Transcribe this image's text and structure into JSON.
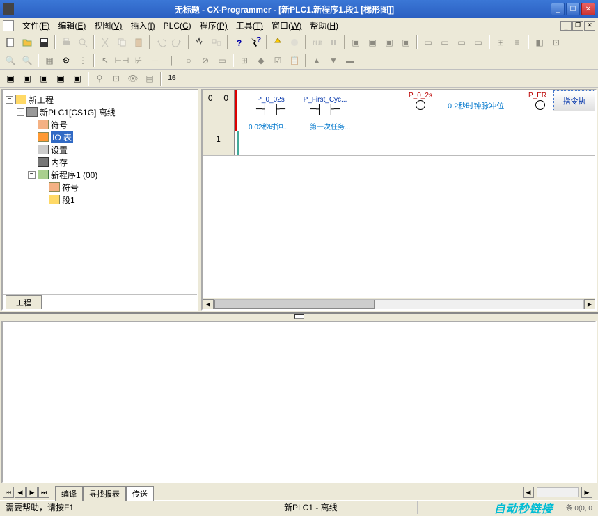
{
  "title": "无标题 - CX-Programmer - [新PLC1.新程序1.段1 [梯形图]]",
  "menu": {
    "file": "文件(",
    "edit": "编辑(",
    "view": "视图(",
    "insert": "插入(",
    "plc": "PLC(",
    "program": "程序(",
    "tools": "工具(",
    "window": "窗口(",
    "help": "帮助(",
    "file_k": "F)",
    "edit_k": "E)",
    "view_k": "V)",
    "insert_k": "I)",
    "plc_k": "C)",
    "program_k": "P)",
    "tools_k": "T)",
    "window_k": "W)",
    "help_k": "H)"
  },
  "toolbar3": {
    "sixteen": "16"
  },
  "tree": {
    "root": "新工程",
    "plc": "新PLC1[CS1G] 离线",
    "symbols": "符号",
    "io": "IO 表",
    "settings": "设置",
    "memory": "内存",
    "program": "新程序1 (00)",
    "psymbols": "符号",
    "section": "段1",
    "tab": "工程"
  },
  "ladder": {
    "rung0_a": "0",
    "rung0_b": "0",
    "rung1": "1",
    "c1": "P_0_02s",
    "c1sub": "0.02秒时钟...",
    "c2": "P_First_Cyc...",
    "c2sub": "第一次任务...",
    "coil1": "P_0_2s",
    "coil1_label": "0.2秒时钟脉冲位",
    "coil2": "P_ER",
    "end": "指令执"
  },
  "output": {
    "t1": "编译",
    "t2": "寻找报表",
    "t3": "传送"
  },
  "status": {
    "help": "需要帮助，请按F1",
    "plc": "新PLC1 - 离线",
    "coord": "条 0(0, 0"
  },
  "watermark": "自动秒链接"
}
